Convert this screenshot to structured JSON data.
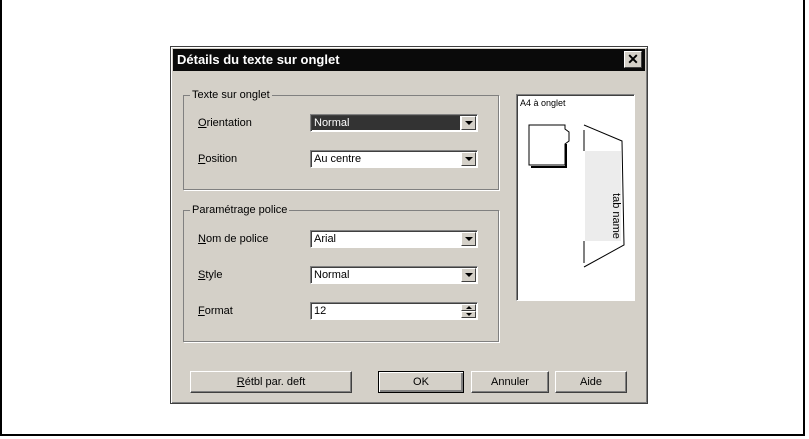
{
  "dialog": {
    "title": "Détails du texte sur onglet",
    "close_glyph": "✕"
  },
  "group_tab_text": {
    "title": "Texte sur onglet",
    "orientation": {
      "label_key": "O",
      "label_rest": "rientation",
      "value": "Normal"
    },
    "position": {
      "label_key": "P",
      "label_rest": "osition",
      "value": "Au centre"
    }
  },
  "group_font": {
    "title": "Paramétrage police",
    "font_name": {
      "label_key": "N",
      "label_rest": "om de police",
      "value": "Arial"
    },
    "style": {
      "label_key": "S",
      "label_rest": "tyle",
      "value": "Normal"
    },
    "format": {
      "label_key": "F",
      "label_rest": "ormat",
      "value": "12"
    }
  },
  "preview": {
    "label": "A4 à onglet",
    "tab_text": "tab name"
  },
  "buttons": {
    "reset_key": "R",
    "reset_rest": "étbl par. deft",
    "ok": "OK",
    "cancel": "Annuler",
    "help": "Aide"
  }
}
